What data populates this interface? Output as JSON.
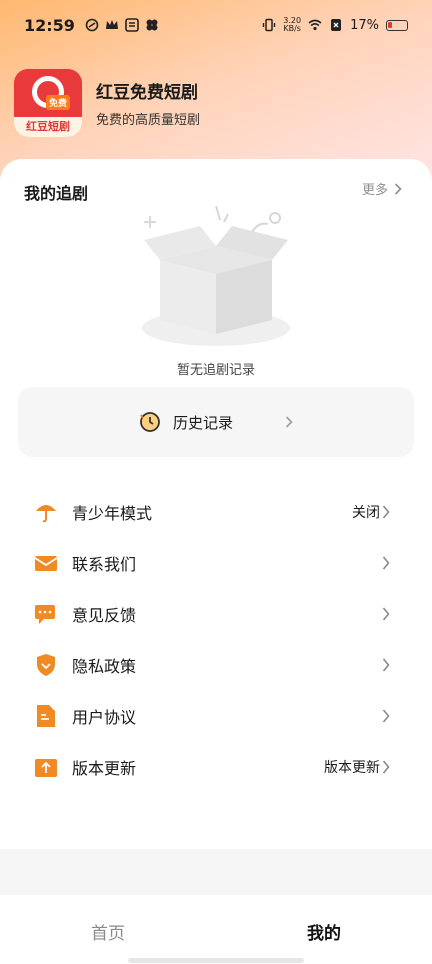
{
  "status_bar": {
    "time": "12:59",
    "net_speed_value": "3.20",
    "net_speed_unit": "KB/s",
    "battery": "17%"
  },
  "app": {
    "name": "红豆免费短剧",
    "slogan": "免费的高质量短剧",
    "logo_tag": "免费",
    "logo_text": "红豆短剧"
  },
  "following": {
    "title": "我的追剧",
    "more": "更多",
    "empty_text": "暂无追剧记录"
  },
  "history": {
    "label": "历史记录"
  },
  "menu": [
    {
      "label": "青少年模式",
      "value": "关闭",
      "icon": "umbrella-icon"
    },
    {
      "label": "联系我们",
      "value": "",
      "icon": "mail-icon"
    },
    {
      "label": "意见反馈",
      "value": "",
      "icon": "chat-icon"
    },
    {
      "label": "隐私政策",
      "value": "",
      "icon": "shield-icon"
    },
    {
      "label": "用户协议",
      "value": "",
      "icon": "document-icon"
    },
    {
      "label": "版本更新",
      "value": "版本更新",
      "icon": "upload-icon"
    }
  ],
  "tabs": [
    {
      "label": "首页",
      "active": false
    },
    {
      "label": "我的",
      "active": true
    }
  ],
  "colors": {
    "accent": "#f08a24",
    "logo_red": "#e83a3a"
  }
}
